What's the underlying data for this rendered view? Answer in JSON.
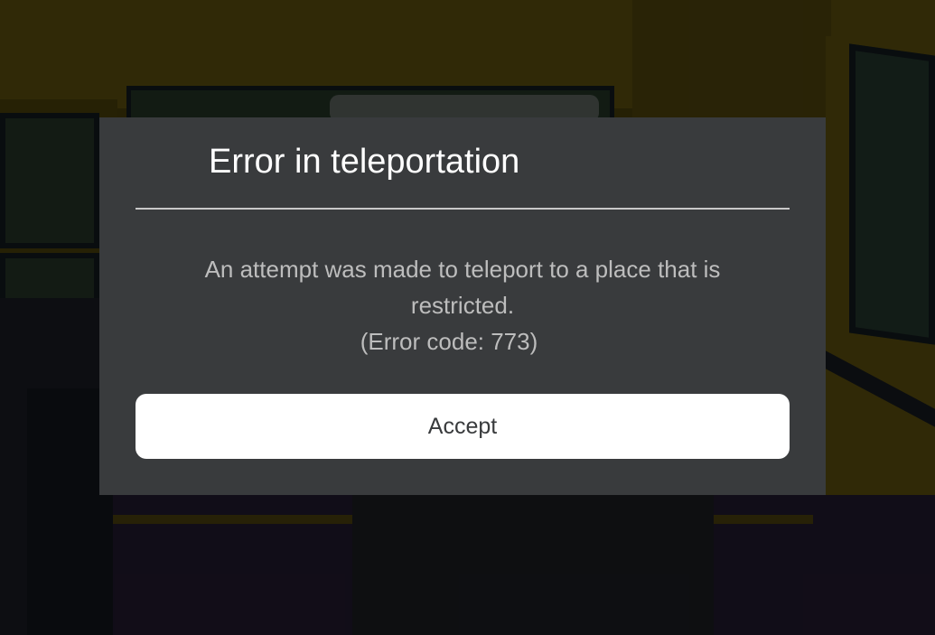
{
  "dialog": {
    "title": "Error in teleportation",
    "message_line1": "An attempt was made to teleport to a place that is",
    "message_line2": "restricted.",
    "error_code": "(Error code: 773)",
    "accept_label": "Accept"
  },
  "colors": {
    "dialog_background": "#393b3d",
    "title_text": "#ffffff",
    "message_text": "#bdbdbd",
    "button_background": "#ffffff",
    "button_text": "#393b3d"
  }
}
